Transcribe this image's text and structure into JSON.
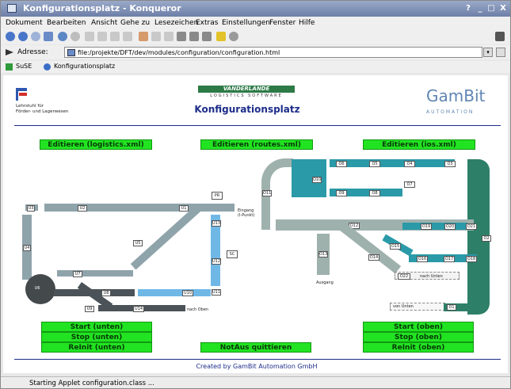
{
  "window": {
    "title": "Konfigurationsplatz - Konqueror",
    "controls": [
      "?",
      "_",
      "□",
      "X"
    ]
  },
  "menu": [
    "Dokument",
    "Bearbeiten",
    "Ansicht",
    "Gehe zu",
    "Lesezeichen",
    "Extras",
    "Einstellungen",
    "Fenster",
    "Hilfe"
  ],
  "address": {
    "label": "Adresse:",
    "value": "file:/projekte/DFT/dev/modules/configuration/configuration.html"
  },
  "bookmarks": [
    "SuSE",
    "Konfigurationsplatz"
  ],
  "page": {
    "left_logo_text": [
      "Lehrstuhl für",
      "Förder- und Lagerwesen"
    ],
    "vdr_logo": "VANDERLANDE",
    "vdr_sub": "LOGISTICS SOFTWARE",
    "title": "Konfigurationsplatz",
    "gambit_name": "GamBit",
    "gambit_sub": "AUTOMATION",
    "edit_buttons": [
      "Editieren (logistics.xml)",
      "Editieren (routes.xml)",
      "Editieren (ios.xml)"
    ],
    "left_controls": [
      "Start (unten)",
      "Stop (unten)",
      "ReInit (unten)"
    ],
    "center_control": "NotAus quittieren",
    "right_controls": [
      "Start (oben)",
      "Stop (oben)",
      "ReInit (oben)"
    ],
    "footer": "Created by GamBit Automation GmbH"
  },
  "diagram_left": {
    "blocks": [
      "U3",
      "U2",
      "U1",
      "U4",
      "U5",
      "U6",
      "U7",
      "U8",
      "U9",
      "U10",
      "U11",
      "U12",
      "U13",
      "U14",
      "PR",
      "SC"
    ],
    "labels": [
      "Eingang (I-Punkt)",
      "nach Oben"
    ]
  },
  "diagram_right": {
    "blocks": [
      "O1",
      "O2",
      "O3",
      "O4",
      "O5",
      "O6",
      "O7",
      "O8",
      "O9",
      "O10",
      "O11",
      "O12",
      "O13",
      "O14",
      "O15",
      "O16",
      "O17",
      "O18",
      "O19",
      "O20",
      "O21",
      "O22"
    ],
    "labels": [
      "nach Unten",
      "von Unten",
      "Ausgang"
    ]
  },
  "status": "Starting Applet configuration.class ...",
  "colors": {
    "button_green": "#22e322",
    "conveyor_gray": "#8fa3ab",
    "teal": "#2a9aa8",
    "dark_green": "#2e7f68",
    "blue_light": "#6fb8e6"
  }
}
